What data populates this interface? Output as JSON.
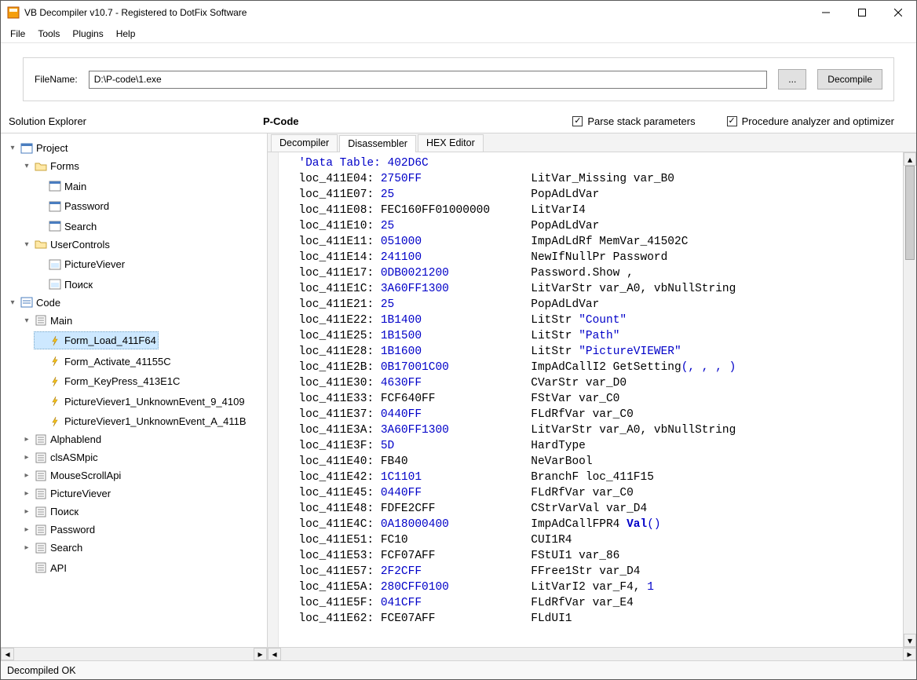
{
  "window": {
    "title": "VB Decompiler v10.7 - Registered to DotFix Software"
  },
  "menu": {
    "file": "File",
    "tools": "Tools",
    "plugins": "Plugins",
    "help": "Help"
  },
  "toolbar": {
    "filename_label": "FileName:",
    "filename_value": "D:\\P-code\\1.exe",
    "browse_label": "...",
    "decompile_label": "Decompile"
  },
  "headers": {
    "solution_explorer": "Solution Explorer",
    "pcode": "P-Code",
    "parse_checkbox": "Parse stack parameters",
    "analyzer_checkbox": "Procedure analyzer and optimizer"
  },
  "tabs": {
    "decompiler": "Decompiler",
    "disassembler": "Disassembler",
    "hex": "HEX Editor"
  },
  "tree": {
    "project": "Project",
    "forms": "Forms",
    "forms_items": [
      "Main",
      "Password",
      "Search"
    ],
    "usercontrols": "UserControls",
    "usercontrols_items": [
      "PictureViever",
      "Поиск"
    ],
    "code": "Code",
    "main": "Main",
    "main_items": [
      "Form_Load_411F64",
      "Form_Activate_41155C",
      "Form_KeyPress_413E1C",
      "PictureViever1_UnknownEvent_9_4109",
      "PictureViever1_UnknownEvent_A_411B"
    ],
    "rest": [
      "Alphablend",
      "clsASMpic",
      "MouseScrollApi",
      "PictureViever",
      "Поиск",
      "Password",
      "Search",
      "API"
    ]
  },
  "code_lines": [
    {
      "type": "cmt",
      "text": "'Data Table: 402D6C"
    },
    {
      "loc": "loc_411E04:",
      "hex": "2750FF",
      "txt": "LitVar_Missing var_B0"
    },
    {
      "loc": "loc_411E07:",
      "hex": "25",
      "txt": "PopAdLdVar"
    },
    {
      "loc": "loc_411E08:",
      "hex": "FEC160FF01000000",
      "txt": "LitVarI4",
      "hexColor": "plain"
    },
    {
      "loc": "loc_411E10:",
      "hex": "25",
      "txt": "PopAdLdVar"
    },
    {
      "loc": "loc_411E11:",
      "hex": "051000",
      "txt": "ImpAdLdRf MemVar_41502C"
    },
    {
      "loc": "loc_411E14:",
      "hex": "241100",
      "txt": "NewIfNullPr Password"
    },
    {
      "loc": "loc_411E17:",
      "hex": "0DB0021200",
      "txt": "Password.Show ,"
    },
    {
      "loc": "loc_411E1C:",
      "hex": "3A60FF1300",
      "txt": "LitVarStr var_A0, vbNullString"
    },
    {
      "loc": "loc_411E21:",
      "hex": "25",
      "txt": "PopAdLdVar"
    },
    {
      "loc": "loc_411E22:",
      "hex": "1B1400",
      "txt": "LitStr ",
      "str": "\"Count\""
    },
    {
      "loc": "loc_411E25:",
      "hex": "1B1500",
      "txt": "LitStr ",
      "str": "\"Path\""
    },
    {
      "loc": "loc_411E28:",
      "hex": "1B1600",
      "txt": "LitStr ",
      "str": "\"PictureVIEWER\""
    },
    {
      "loc": "loc_411E2B:",
      "hex": "0B17001C00",
      "txt": "ImpAdCallI2 GetSetting",
      "str": "(, , , )"
    },
    {
      "loc": "loc_411E30:",
      "hex": "4630FF",
      "txt": "CVarStr var_D0"
    },
    {
      "loc": "loc_411E33:",
      "hex": "FCF640FF",
      "txt": "FStVar var_C0",
      "hexColor": "plain"
    },
    {
      "loc": "loc_411E37:",
      "hex": "0440FF",
      "txt": "FLdRfVar var_C0"
    },
    {
      "loc": "loc_411E3A:",
      "hex": "3A60FF1300",
      "txt": "LitVarStr var_A0, vbNullString"
    },
    {
      "loc": "loc_411E3F:",
      "hex": "5D",
      "txt": "HardType"
    },
    {
      "loc": "loc_411E40:",
      "hex": "FB40",
      "txt": "NeVarBool",
      "hexColor": "plain"
    },
    {
      "loc": "loc_411E42:",
      "hex": "1C1101",
      "txt": "BranchF loc_411F15"
    },
    {
      "loc": "loc_411E45:",
      "hex": "0440FF",
      "txt": "FLdRfVar var_C0"
    },
    {
      "loc": "loc_411E48:",
      "hex": "FDFE2CFF",
      "txt": "CStrVarVal var_D4",
      "hexColor": "plain"
    },
    {
      "loc": "loc_411E4C:",
      "hex": "0A18000400",
      "txt": "ImpAdCallFPR4 ",
      "kw": "Val",
      "str": "()"
    },
    {
      "loc": "loc_411E51:",
      "hex": "FC10",
      "txt": "CUI1R4",
      "hexColor": "plain"
    },
    {
      "loc": "loc_411E53:",
      "hex": "FCF07AFF",
      "txt": "FStUI1 var_86",
      "hexColor": "plain"
    },
    {
      "loc": "loc_411E57:",
      "hex": "2F2CFF",
      "txt": "FFree1Str var_D4"
    },
    {
      "loc": "loc_411E5A:",
      "hex": "280CFF0100",
      "txt": "LitVarI2 var_F4, ",
      "str": "1"
    },
    {
      "loc": "loc_411E5F:",
      "hex": "041CFF",
      "txt": "FLdRfVar var_E4"
    },
    {
      "loc": "loc_411E62:",
      "hex": "FCE07AFF",
      "txt": "FLdUI1",
      "hexColor": "plain"
    }
  ],
  "status": {
    "text": "Decompiled OK"
  }
}
